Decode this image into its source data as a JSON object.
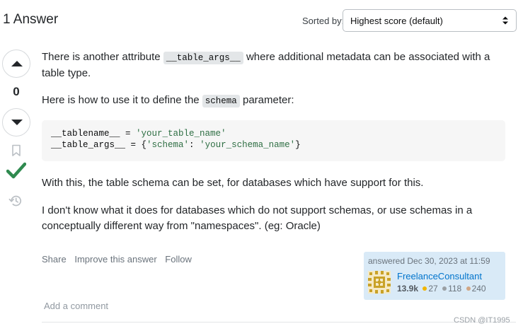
{
  "header": {
    "answer_count": "1 Answer",
    "sort_label": "Sorted by:",
    "sort_selected": "Highest score (default)"
  },
  "vote": {
    "score": "0",
    "accepted": true
  },
  "post": {
    "p1_before": "There is another attribute ",
    "p1_code": "__table_args__",
    "p1_after": " where additional metadata can be associated with a table type.",
    "p2_before": "Here is how to use it to define the ",
    "p2_code": "schema",
    "p2_after": " parameter:",
    "code_line1_name": "__tablename__ = ",
    "code_line1_str": "'your_table_name'",
    "code_line2_name": "__table_args__ = {",
    "code_line2_key": "'schema'",
    "code_line2_sep": ": ",
    "code_line2_val": "'your_schema_name'",
    "code_line2_end": "}",
    "p3": "With this, the table schema can be set, for databases which have support for this.",
    "p4": "I don't know what it does for databases which do not support schemas, or use schemas in a conceptually different way from \"namespaces\". (eg: Oracle)"
  },
  "menu": {
    "share": "Share",
    "improve": "Improve this answer",
    "follow": "Follow"
  },
  "user_card": {
    "answered": "answered Dec 30, 2023 at 11:59",
    "name": "FreelanceConsultant",
    "reputation": "13.9k",
    "gold": "27",
    "silver": "118",
    "bronze": "240"
  },
  "comments": {
    "add": "Add a comment"
  },
  "watermark": "CSDN @IT1995",
  "colors": {
    "accepted_check": "#2f8a4f",
    "link": "#0074cc",
    "gold": "#f1b600",
    "silver": "#9a9fa3",
    "bronze": "#d1a684",
    "card_bg": "#d9eaf7",
    "code_bg": "#f6f6f6"
  },
  "icons": {
    "vote_up": "triangle-up-icon",
    "vote_down": "triangle-down-icon",
    "bookmark": "bookmark-icon",
    "accepted": "checkmark-icon",
    "history": "history-icon",
    "sort": "updown-caret-icon"
  }
}
